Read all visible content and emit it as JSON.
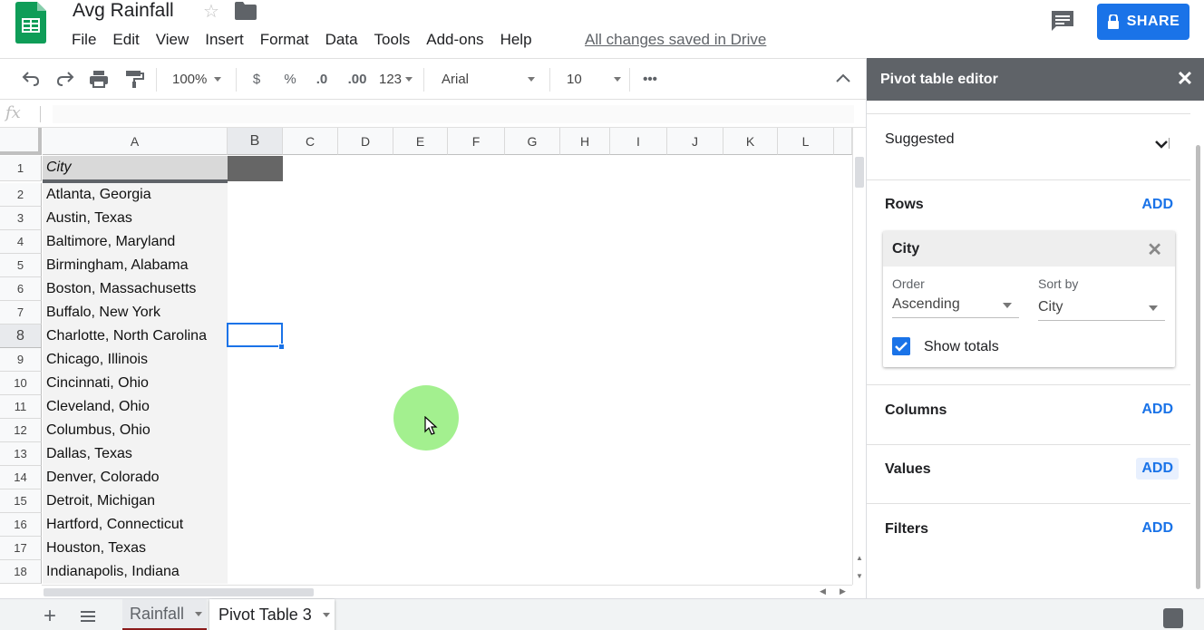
{
  "header": {
    "doc_title": "Avg Rainfall",
    "menu": [
      "File",
      "Edit",
      "View",
      "Insert",
      "Format",
      "Data",
      "Tools",
      "Add-ons",
      "Help"
    ],
    "saved_status": "All changes saved in Drive",
    "share_label": "SHARE",
    "brand_color": "#0f9d58"
  },
  "toolbar": {
    "zoom": "100%",
    "currency": "$",
    "percent": "%",
    "decrease_decimal": ".0",
    "increase_decimal": ".00",
    "more_formats": "123",
    "font": "Arial",
    "font_size": "10",
    "more": "•••"
  },
  "formula_bar": {
    "fx": "fx",
    "value": ""
  },
  "grid": {
    "columns": [
      "A",
      "B",
      "C",
      "D",
      "E",
      "F",
      "G",
      "H",
      "I",
      "J",
      "K",
      "L"
    ],
    "rows": [
      "1",
      "2",
      "3",
      "4",
      "5",
      "6",
      "7",
      "8",
      "9",
      "10",
      "11",
      "12",
      "13",
      "14",
      "15",
      "16",
      "17",
      "18"
    ],
    "column_a": [
      "City",
      "Atlanta, Georgia",
      "Austin, Texas",
      "Baltimore, Maryland",
      "Birmingham, Alabama",
      "Boston, Massachusetts",
      "Buffalo, New York",
      "Charlotte, North Carolina",
      "Chicago, Illinois",
      "Cincinnati, Ohio",
      "Cleveland, Ohio",
      "Columbus, Ohio",
      "Dallas, Texas",
      "Denver, Colorado",
      "Detroit, Michigan",
      "Hartford, Connecticut",
      "Houston, Texas",
      "Indianapolis, Indiana"
    ],
    "selected_cell": "B8"
  },
  "sheets": {
    "tabs": [
      "Rainfall",
      "Pivot Table 3"
    ],
    "active": "Pivot Table 3"
  },
  "pivot_editor": {
    "title": "Pivot table editor",
    "suggested": "Suggested",
    "rows_title": "Rows",
    "columns_title": "Columns",
    "values_title": "Values",
    "filters_title": "Filters",
    "add_label": "ADD",
    "row_field": {
      "name": "City",
      "order_label": "Order",
      "order_value": "Ascending",
      "sort_by_label": "Sort by",
      "sort_by_value": "City",
      "show_totals_label": "Show totals",
      "show_totals": true
    }
  }
}
